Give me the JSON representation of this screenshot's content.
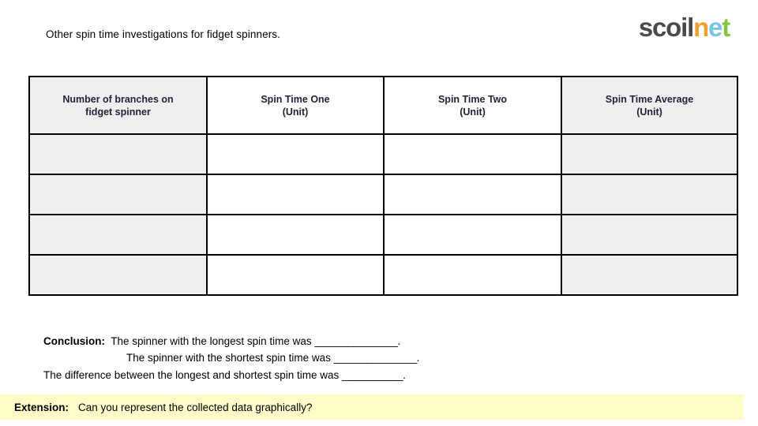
{
  "header": {
    "title": "Other spin time investigations for fidget spinners.",
    "logo": {
      "part1": "scoil",
      "part2": "n",
      "part3": "e",
      "part4": "t",
      "color_dark": "#4a4a4a",
      "color_orange": "#f0a030",
      "color_blue": "#79c4e8",
      "color_green": "#86c33e"
    }
  },
  "table": {
    "columns": [
      {
        "line1": "Number of branches on",
        "line2": "fidget spinner",
        "shaded": true
      },
      {
        "line1": "Spin Time One",
        "line2": "(Unit)",
        "shaded": false
      },
      {
        "line1": "Spin Time Two",
        "line2": "(Unit)",
        "shaded": false
      },
      {
        "line1": "Spin Time Average",
        "line2": "(Unit)",
        "shaded": true
      }
    ],
    "rows": [
      [
        "",
        "",
        "",
        ""
      ],
      [
        "",
        "",
        "",
        ""
      ],
      [
        "",
        "",
        "",
        ""
      ],
      [
        "",
        "",
        "",
        ""
      ]
    ],
    "shade_color": "#efefef",
    "border_color": "#000000"
  },
  "conclusion": {
    "label": "Conclusion:",
    "line1_text": "  The spinner with the longest spin time was ",
    "line1_blank": "_______________",
    "line1_end": ".",
    "line2_text": "The spinner with the shortest spin time was ",
    "line2_blank": "_______________",
    "line2_end": ".",
    "line3_text": "The difference between the longest and shortest spin time was ",
    "line3_blank": "___________",
    "line3_end": "."
  },
  "extension": {
    "label": "Extension:",
    "text": "Can you represent the collected data graphically?",
    "background": "#fdfdca"
  }
}
